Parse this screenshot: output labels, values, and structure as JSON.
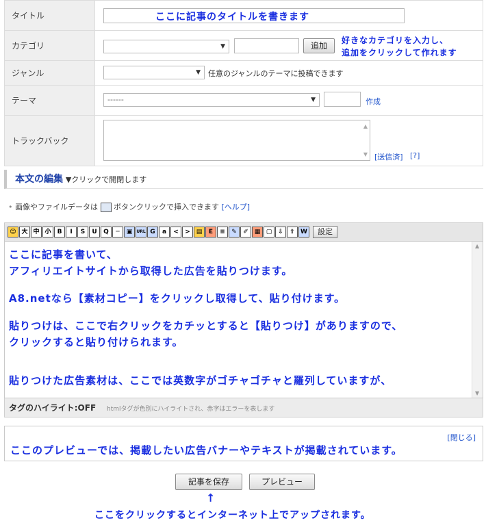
{
  "form": {
    "title_label": "タイトル",
    "title_annotation": "ここに記事のタイトルを書きます",
    "category_label": "カテゴリ",
    "category_add_button": "追加",
    "category_annotation_1": "好きなカテゴリを入力し、",
    "category_annotation_2": "追加をクリックして作れます",
    "genre_label": "ジャンル",
    "genre_note": "任意のジャンルのテーマに投稿できます",
    "theme_label": "テーマ",
    "theme_select_value": "------",
    "theme_create_link": "作成",
    "trackback_label": "トラックバック",
    "trackback_sent_link": "[送信済]",
    "trackback_help_link": "[?]"
  },
  "body_section": {
    "heading": "本文の編集",
    "toggle_text": "▼クリックで開閉します",
    "hint_prefix": "画像やファイルデータは",
    "hint_suffix": "ボタンクリックで挿入できます",
    "help_link": "[ヘルプ]",
    "settings_button": "設定",
    "toolbar_icons": [
      "😊",
      "大",
      "中",
      "小",
      "B",
      "I",
      "S",
      "U",
      "Q",
      "─",
      "▣",
      "URL",
      "G",
      "a",
      "<",
      ">",
      "▤",
      "E",
      "≡",
      "✎",
      "✐",
      "▦",
      "▢",
      "⇩",
      "⇧",
      "W"
    ]
  },
  "editor": {
    "line_1": "ここに記事を書いて、",
    "line_2": "アフィリエイトサイトから取得した広告を貼りつけます。",
    "line_3": "A8.netなら【素材コピー】をクリックし取得して、貼り付けます。",
    "line_4": "貼りつけは、ここで右クリックをカチッとすると【貼りつけ】がありますので、",
    "line_5": "クリックすると貼り付けられます。",
    "line_6": "貼りつけた広告素材は、ここでは英数字がゴチャゴチャと羅列していますが、"
  },
  "tagbar": {
    "label": "タグのハイライト:OFF",
    "description": "htmlタグが色別にハイライトされ、赤字はエラーを表します"
  },
  "preview": {
    "close_link": "[閉じる]",
    "annotation": "ここのプレビューでは、掲載したい広告バナーやテキストが掲載されています。"
  },
  "actions": {
    "save_button": "記事を保存",
    "preview_button": "プレビュー",
    "arrow": "↑",
    "annotation": "ここをクリックするとインターネット上でアップされます。"
  }
}
